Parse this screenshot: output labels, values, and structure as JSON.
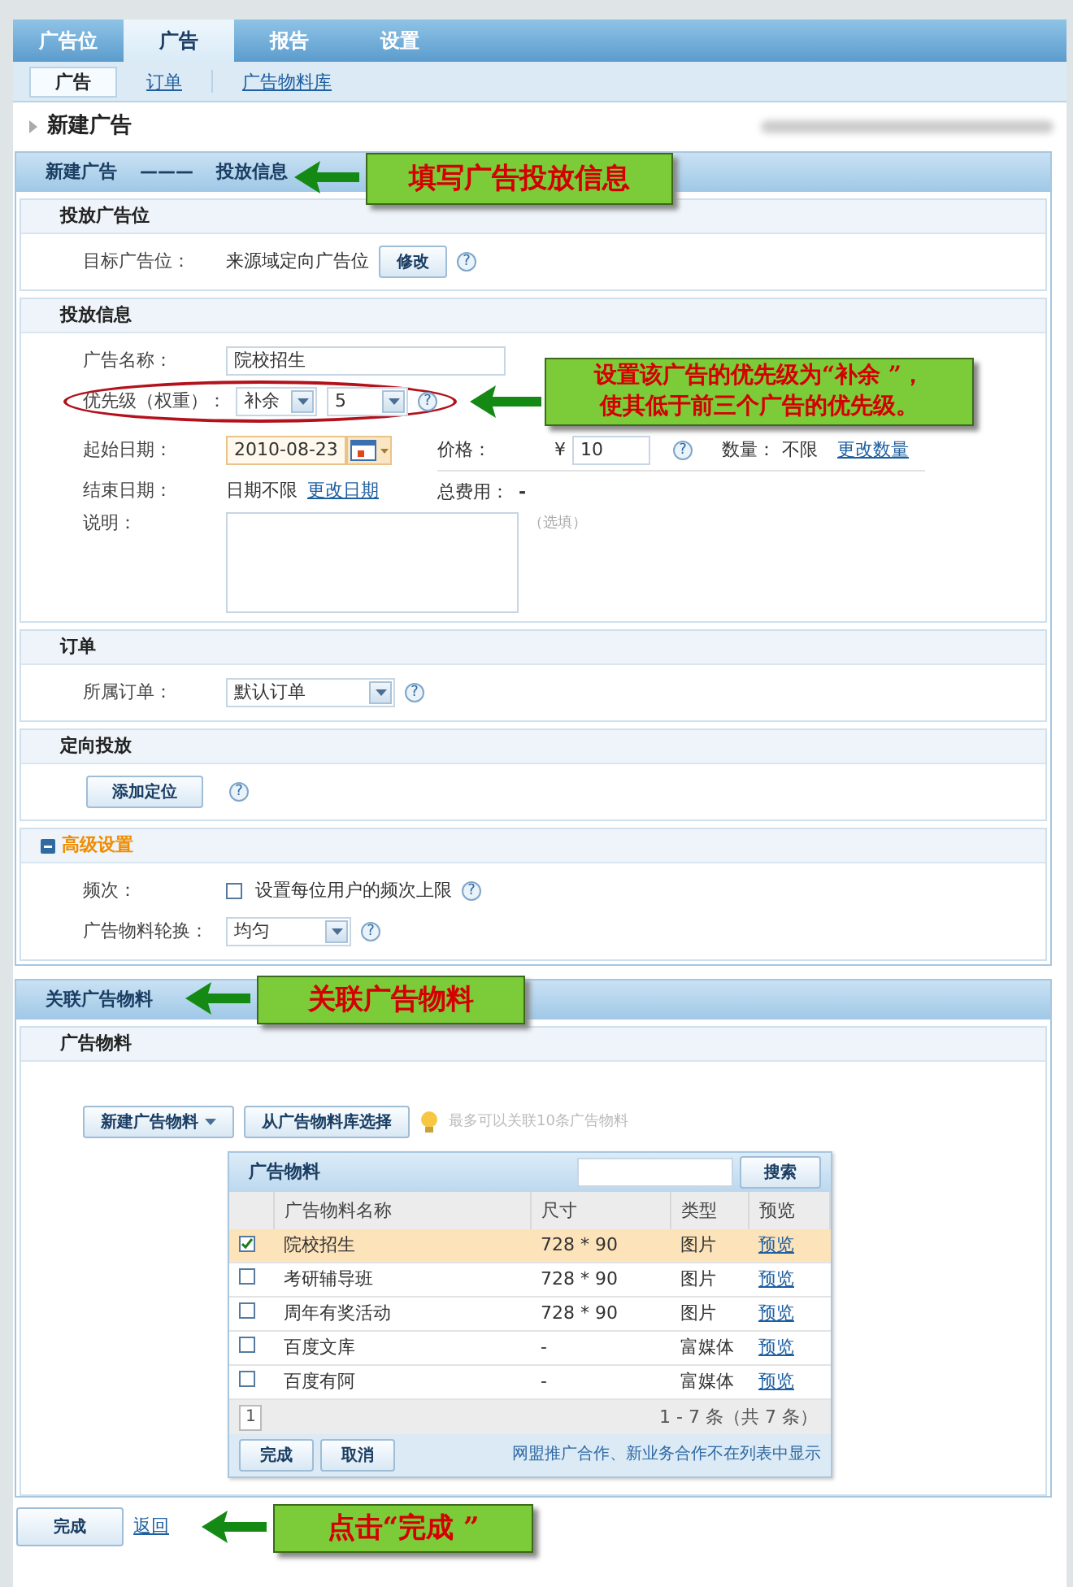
{
  "nav": {
    "tabs": [
      {
        "label": "广告位",
        "selected": false
      },
      {
        "label": "广告",
        "selected": true
      },
      {
        "label": "报告",
        "selected": false
      },
      {
        "label": "设置",
        "selected": false
      }
    ],
    "subtabs": [
      {
        "label": "广告",
        "selected": true
      },
      {
        "label": "订单",
        "selected": false
      },
      {
        "label": "广告物料库",
        "selected": false
      }
    ]
  },
  "page_title": "新建广告",
  "info_section": {
    "header": [
      "新建广告",
      "———",
      "投放信息"
    ],
    "callout": "填写广告投放信息",
    "placement": {
      "title": "投放广告位",
      "label": "目标广告位：",
      "value": "来源域定向广告位",
      "button": "修改",
      "help": "?"
    },
    "delivery": {
      "title": "投放信息",
      "name": {
        "label": "广告名称：",
        "value": "院校招生"
      },
      "priority": {
        "label": "优先级（权重）：",
        "level_select": "补余",
        "weight_select": "5",
        "help": "?",
        "callout": [
          "设置该广告的优先级为“补余 ”，",
          "使其低于前三个广告的优先级。"
        ]
      },
      "start_date": {
        "label": "起始日期：",
        "value": "2010-08-23"
      },
      "end_date": {
        "label": "结束日期：",
        "value": "日期不限",
        "link": "更改日期"
      },
      "note": {
        "label": "说明：",
        "hint": "（选填）"
      },
      "price": {
        "label": "价格：",
        "currency": "¥",
        "value": "10",
        "help": "?"
      },
      "quantity": {
        "label": "数量：",
        "value": "不限",
        "link": "更改数量"
      },
      "total": {
        "label": "总费用：",
        "value": "-"
      }
    },
    "order": {
      "title": "订单",
      "label": "所属订单：",
      "value": "默认订单",
      "help": "?"
    },
    "targeting": {
      "title": "定向投放",
      "button": "添加定位",
      "help": "?"
    },
    "advanced": {
      "title": "高级设置",
      "expanded": true,
      "frequency": {
        "label": "频次：",
        "checked": false,
        "text": "设置每位用户的频次上限",
        "help": "?"
      },
      "rotation": {
        "label": "广告物料轮换：",
        "value": "均匀",
        "help": "?"
      }
    }
  },
  "creative_section": {
    "header": "关联广告物料",
    "callout": "关联广告物料",
    "title": "广告物料",
    "new_button": "新建广告物料",
    "library_button": "从广告物料库选择",
    "tip": "最多可以关联10条广告物料",
    "picker": {
      "title": "广告物料",
      "search_button": "搜索",
      "columns": [
        "广告物料名称",
        "尺寸",
        "类型",
        "预览"
      ],
      "rows": [
        {
          "checked": true,
          "selected": true,
          "name": "院校招生",
          "size": "728 * 90",
          "type": "图片",
          "preview": "预览"
        },
        {
          "checked": false,
          "selected": false,
          "name": "考研辅导班",
          "size": "728 * 90",
          "type": "图片",
          "preview": "预览"
        },
        {
          "checked": false,
          "selected": false,
          "name": "周年有奖活动",
          "size": "728 * 90",
          "type": "图片",
          "preview": "预览"
        },
        {
          "checked": false,
          "selected": false,
          "name": "百度文库",
          "size": "-",
          "type": "富媒体",
          "preview": "预览"
        },
        {
          "checked": false,
          "selected": false,
          "name": "百度有阿",
          "size": "-",
          "type": "富媒体",
          "preview": "预览"
        }
      ],
      "page": "1",
      "range": "1 - 7 条（共 7 条）",
      "done": "完成",
      "cancel": "取消",
      "note": "网盟推广合作、新业务合作不在列表中显示"
    }
  },
  "footer": {
    "done": "完成",
    "back": "返回",
    "callout": "点击“完成 ”"
  }
}
